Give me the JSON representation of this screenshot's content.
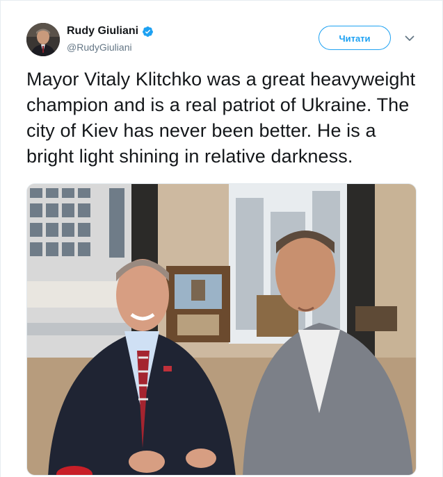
{
  "author": {
    "display_name": "Rudy Giuliani",
    "handle": "@RudyGiuliani",
    "verified": true,
    "verified_icon": "verified-badge-icon"
  },
  "actions": {
    "follow_label": "Читати",
    "more_icon": "chevron-down-icon"
  },
  "tweet": {
    "text": "Mayor Vitaly Klitchko was a great heavyweight champion and is a real patriot of Ukraine. The city of Kiev has never been better. He is a bright light shining in relative darkness."
  },
  "colors": {
    "accent": "#1da1f2",
    "text": "#14171a",
    "muted": "#657786"
  }
}
